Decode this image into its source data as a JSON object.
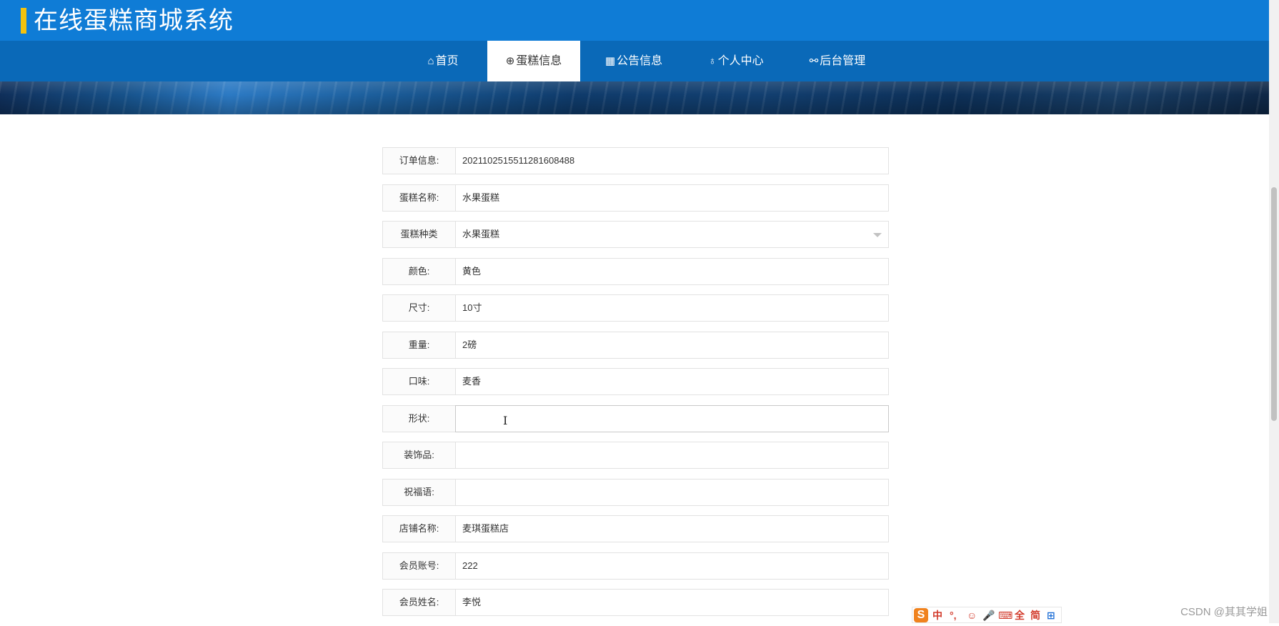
{
  "header": {
    "title": "在线蛋糕商城系统",
    "accent_color": "#f4c20d",
    "background_color": "#0f7cd6"
  },
  "nav": {
    "background_color": "#0a69b8",
    "items": [
      {
        "icon": "home-icon",
        "glyph": "⌂",
        "label": "首页",
        "active": false
      },
      {
        "icon": "globe-icon",
        "glyph": "⊕",
        "label": "蛋糕信息",
        "active": true
      },
      {
        "icon": "grid-icon",
        "glyph": "▦",
        "label": "公告信息",
        "active": false
      },
      {
        "icon": "user-icon",
        "glyph": "♁",
        "label": "个人中心",
        "active": false
      },
      {
        "icon": "link-icon",
        "glyph": "⚯",
        "label": "后台管理",
        "active": false
      }
    ]
  },
  "form": {
    "fields": [
      {
        "label": "订单信息:",
        "value": "20211025155112816084​88"
      },
      {
        "label": "蛋糕名称:",
        "value": "水果蛋糕"
      },
      {
        "label": "蛋糕种类",
        "value": "水果蛋糕",
        "type": "select"
      },
      {
        "label": "颜色:",
        "value": "黄色"
      },
      {
        "label": "尺寸:",
        "value": "10寸"
      },
      {
        "label": "重量:",
        "value": "2磅"
      },
      {
        "label": "口味:",
        "value": "麦香"
      },
      {
        "label": "形状:",
        "value": "",
        "focused": true
      },
      {
        "label": "装饰品:",
        "value": ""
      },
      {
        "label": "祝福语:",
        "value": ""
      },
      {
        "label": "店铺名称:",
        "value": "麦琪蛋糕店"
      },
      {
        "label": "会员账号:",
        "value": "222"
      },
      {
        "label": "会员姓名:",
        "value": "李悦"
      }
    ]
  },
  "ime": {
    "logo": "S",
    "keys": [
      "中",
      "°,",
      "☺",
      "🎤",
      "⌨",
      "全",
      "简",
      "⊞"
    ]
  },
  "watermark": "CSDN @其其学姐"
}
